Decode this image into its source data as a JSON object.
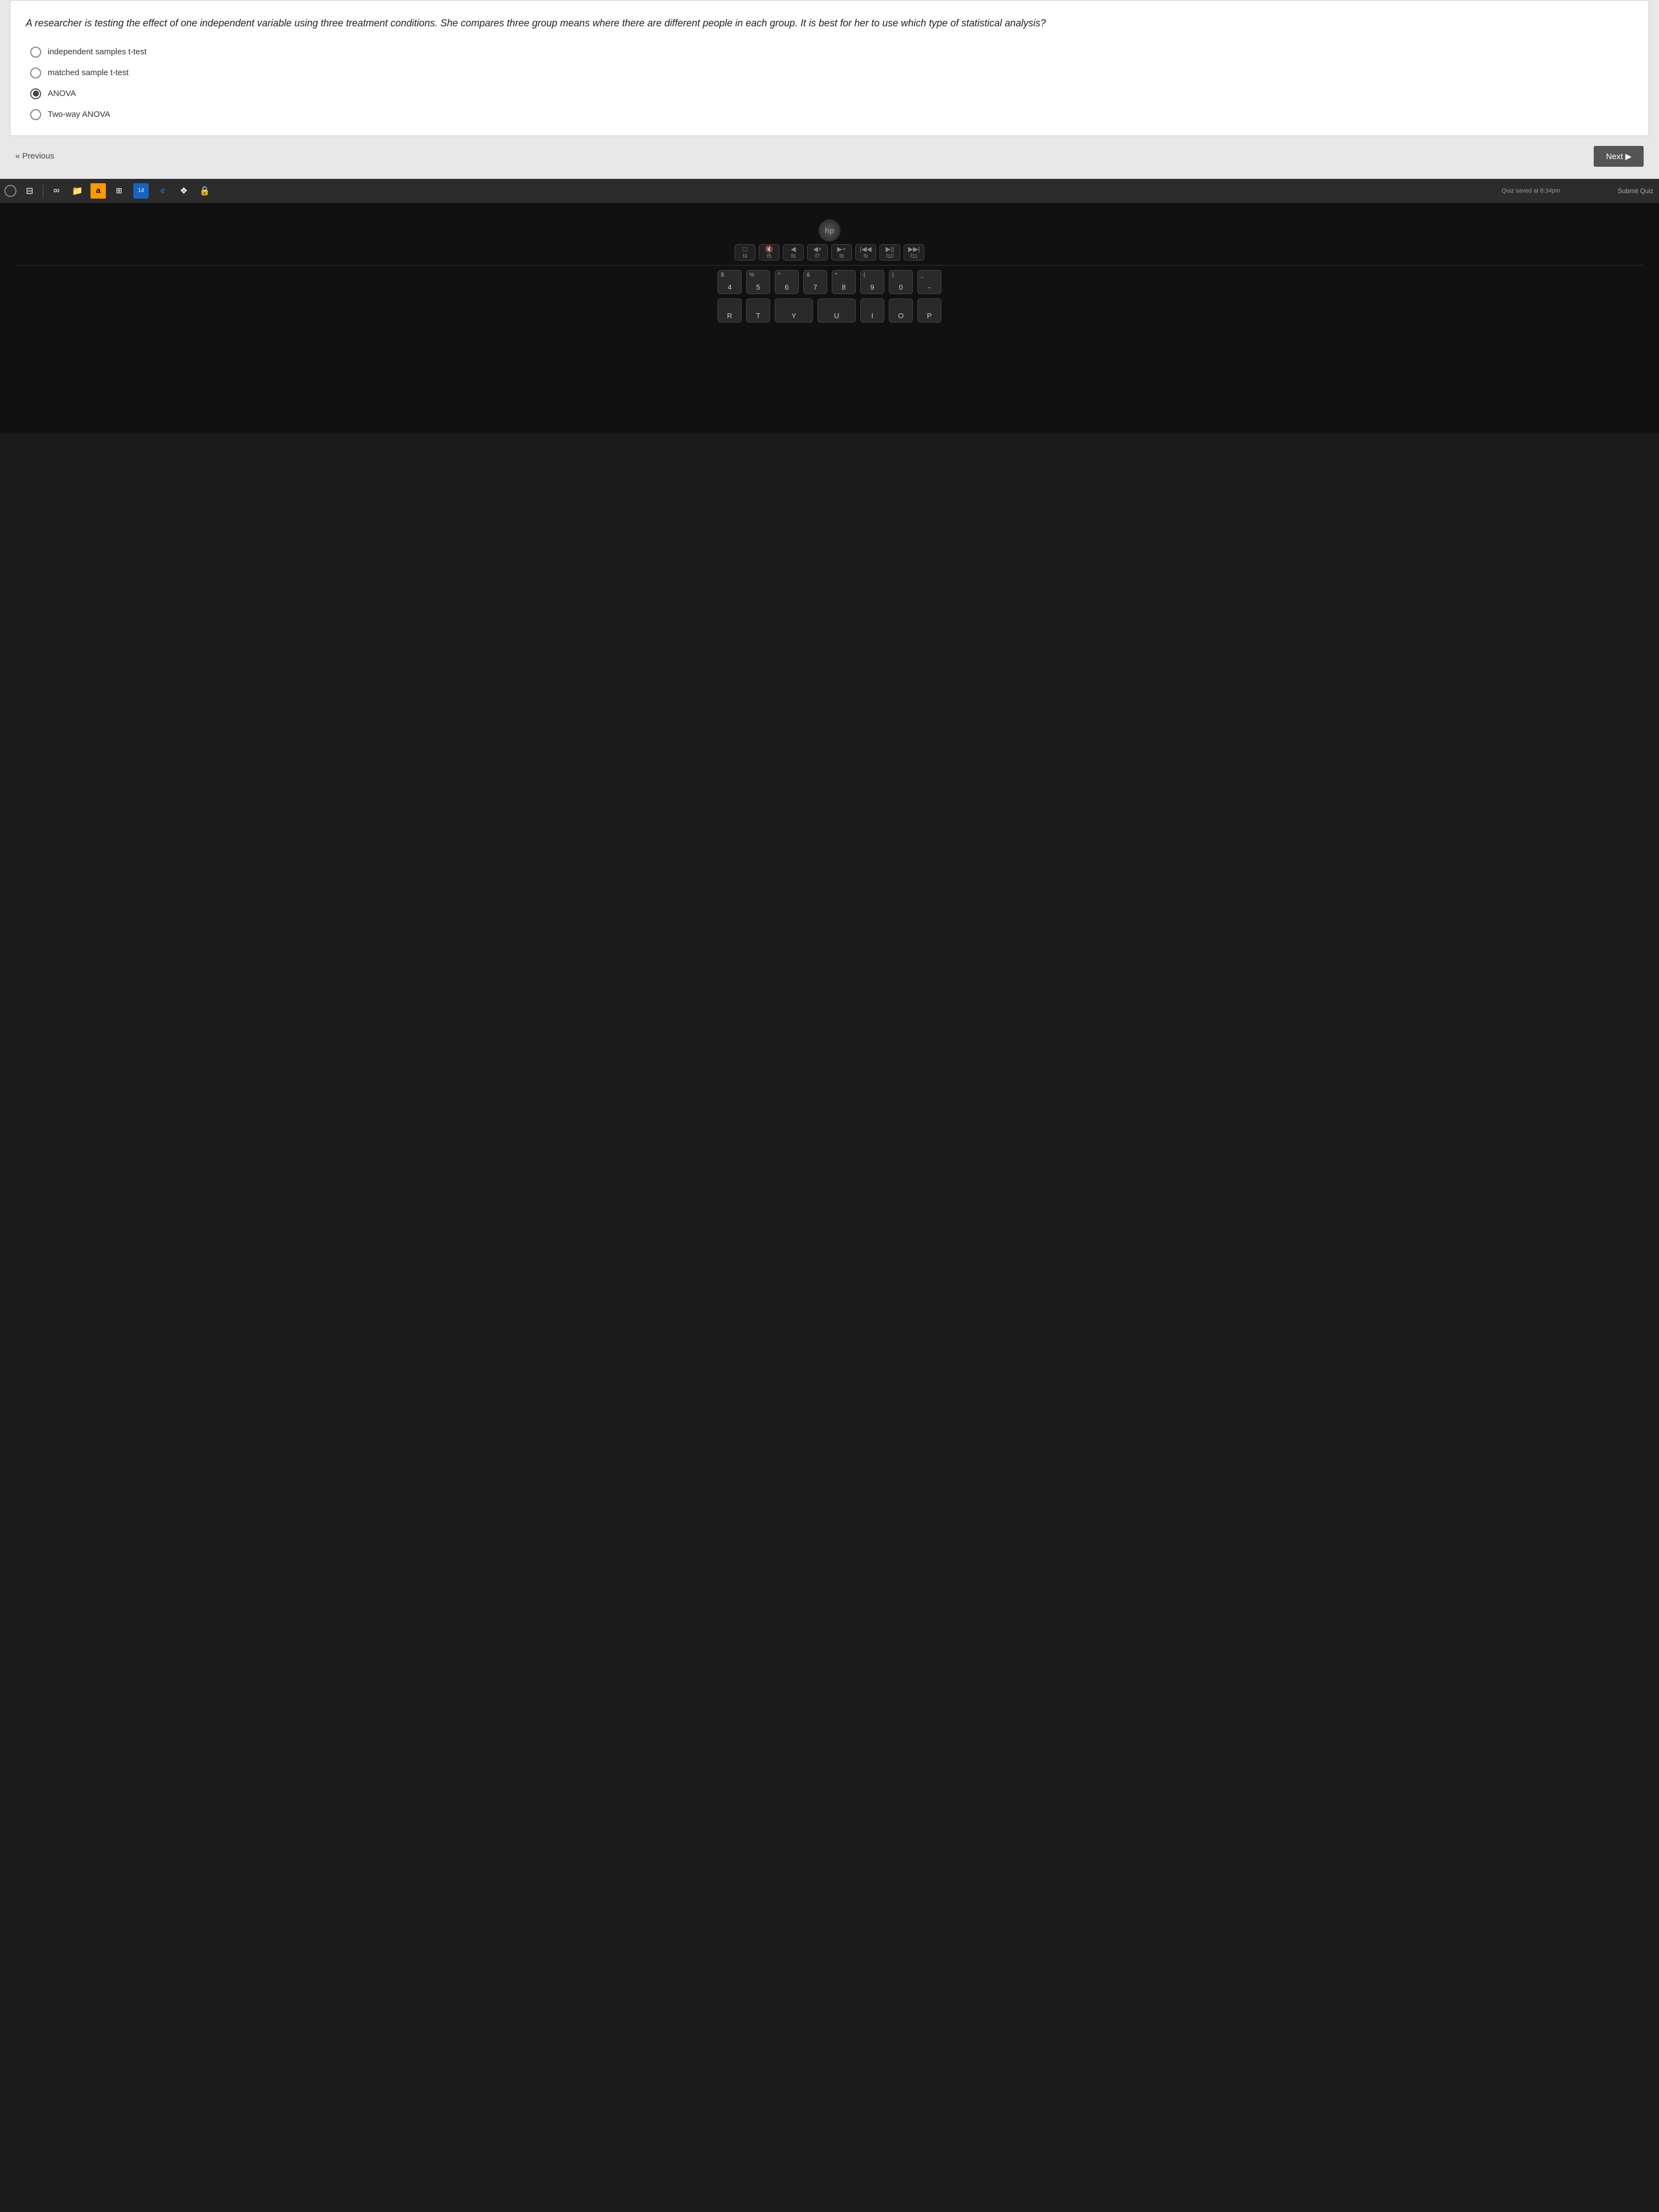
{
  "quiz": {
    "question": "A researcher is testing the effect of one independent variable using three treatment conditions. She compares three group means where there are different people in each group. It is best for her to use which type of statistical analysis?",
    "options": [
      {
        "id": "opt1",
        "label": "independent samples t-test",
        "selected": false
      },
      {
        "id": "opt2",
        "label": "matched sample t-test",
        "selected": false
      },
      {
        "id": "opt3",
        "label": "ANOVA",
        "selected": true
      },
      {
        "id": "opt4",
        "label": "Two-way ANOVA",
        "selected": false
      }
    ],
    "saved_text": "Quiz saved at 8:34pm",
    "submit_label": "Submit Quiz",
    "prev_label": "« Previous",
    "next_label": "Next ▶"
  },
  "taskbar": {
    "apps": [
      {
        "name": "circle-button",
        "label": "O"
      },
      {
        "name": "task-view",
        "label": "⊟"
      },
      {
        "name": "divider1",
        "label": "|"
      },
      {
        "name": "infinity-icon",
        "label": "∞"
      },
      {
        "name": "files-icon",
        "label": "📁"
      },
      {
        "name": "amazon-icon",
        "label": "a"
      },
      {
        "name": "windows-store",
        "label": "⊞"
      },
      {
        "name": "badge-14-app",
        "label": "",
        "badge": "14"
      },
      {
        "name": "edge-icon",
        "label": "e"
      },
      {
        "name": "dropbox-icon",
        "label": "❖"
      },
      {
        "name": "security-icon",
        "label": "🔒"
      }
    ]
  },
  "keyboard": {
    "fn_row": [
      {
        "label": "f4",
        "icon": "□"
      },
      {
        "label": "f5",
        "icon": "⊙"
      },
      {
        "label": "f6",
        "icon": "◀"
      },
      {
        "label": "f7",
        "icon": "◀"
      },
      {
        "label": "f8",
        "icon": "▶▶"
      },
      {
        "label": "f9",
        "icon": "|◀◀"
      },
      {
        "label": "f10",
        "icon": "▶||"
      },
      {
        "label": "f11",
        "icon": "▶▶|"
      }
    ],
    "number_row": [
      {
        "top": "$",
        "bottom": "4"
      },
      {
        "top": "%",
        "bottom": "5"
      },
      {
        "top": "^",
        "bottom": "6"
      },
      {
        "top": "&",
        "bottom": "7"
      },
      {
        "top": "*",
        "bottom": "8"
      },
      {
        "top": "(",
        "bottom": "9"
      },
      {
        "top": ")",
        "bottom": "0"
      },
      {
        "top": "_",
        "bottom": "-"
      }
    ],
    "letter_row": [
      {
        "label": "R"
      },
      {
        "label": "T"
      },
      {
        "label": "Y"
      },
      {
        "label": "U"
      },
      {
        "label": "I"
      },
      {
        "label": "O"
      },
      {
        "label": "P"
      }
    ]
  }
}
